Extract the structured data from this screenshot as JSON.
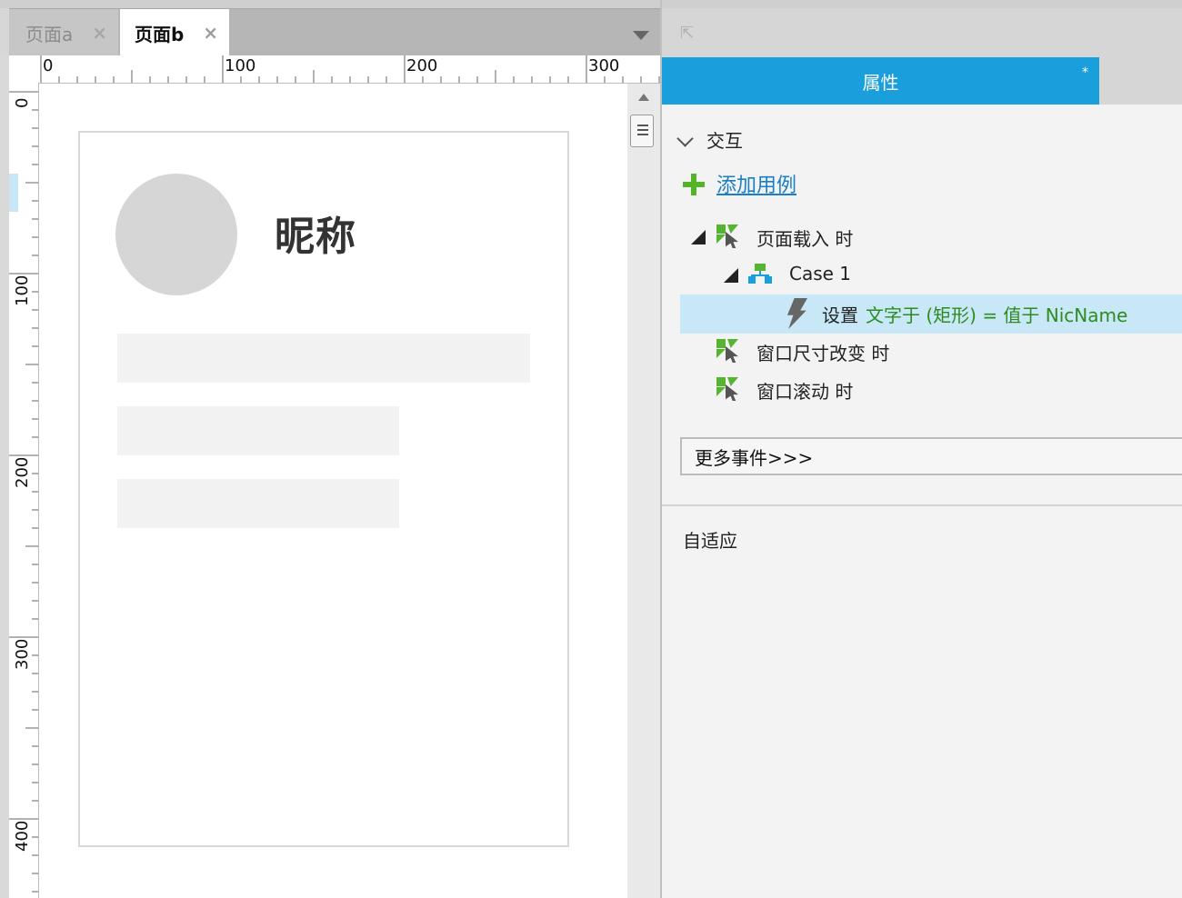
{
  "tabs": [
    {
      "label": "页面a",
      "active": false
    },
    {
      "label": "页面b",
      "active": true
    }
  ],
  "tab_close_glyph": "×",
  "ruler": {
    "horizontal": [
      "0",
      "100",
      "200",
      "300"
    ],
    "vertical": [
      "0",
      "100",
      "200",
      "300",
      "400"
    ]
  },
  "canvas": {
    "nickname": "昵称"
  },
  "panel": {
    "active_tab": "属性",
    "modified_marker": "*",
    "section_title": "交互",
    "add_case_label": "添加用例",
    "events": [
      {
        "label": "页面载入 时"
      },
      {
        "label": "窗口尺寸改变 时"
      },
      {
        "label": "窗口滚动 时"
      }
    ],
    "case_label": "Case 1",
    "action_verb": "设置",
    "action_detail": "文字于 (矩形) = 值于 NicName",
    "more_events_label": "更多事件>>>",
    "adaptive_label": "自适应"
  },
  "colors": {
    "accent": "#1a9fdc",
    "event_icon": "#57b431",
    "action_text": "#2e8b1f",
    "selected_row": "#c8e8f7",
    "link": "#1a7fc4"
  }
}
